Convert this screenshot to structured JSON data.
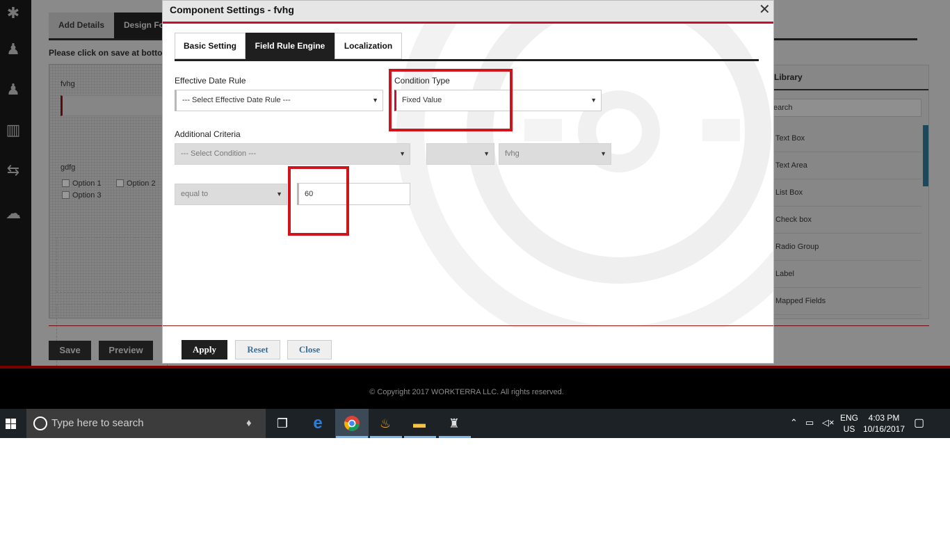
{
  "app": {
    "tabs": [
      "Add Details",
      "Design Fo"
    ],
    "hint": "Please click on save at botton",
    "canvas": {
      "field1_label": "fvhg",
      "field2_label": "gdfg",
      "options": [
        "Option 1",
        "Option 2",
        "Option 3"
      ]
    },
    "library": {
      "title": "Library",
      "search_placeholder": "earch",
      "items": [
        "Text Box",
        "Text Area",
        "List Box",
        "Check box",
        "Radio Group",
        "Label",
        "Mapped Fields"
      ]
    },
    "buttons": {
      "save": "Save",
      "preview": "Preview"
    },
    "copyright": "© Copyright 2017 WORKTERRA LLC. All rights reserved."
  },
  "modal": {
    "title": "Component Settings - fvhg",
    "close_glyph": "✕",
    "tabs": [
      {
        "label": "Basic Setting"
      },
      {
        "label": "Field Rule Engine"
      },
      {
        "label": "Localization"
      }
    ],
    "effective_date_rule": {
      "label": "Effective Date Rule",
      "value": "--- Select Effective Date Rule ---"
    },
    "condition_type": {
      "label": "Condition Type",
      "value": "Fixed Value"
    },
    "additional_criteria": {
      "label": "Additional Criteria",
      "condition": "--- Select Condition ---",
      "middle_select": "",
      "field_select": "fvhg",
      "operator": "equal to",
      "value": "60"
    },
    "buttons": {
      "apply": "Apply",
      "reset": "Reset",
      "close": "Close"
    },
    "accent_color": "#c8102e",
    "highlight_color": "#d0141c"
  },
  "taskbar": {
    "search_placeholder": "Type here to search",
    "lang_line1": "ENG",
    "lang_line2": "US",
    "time": "4:03 PM",
    "date": "10/16/2017"
  }
}
